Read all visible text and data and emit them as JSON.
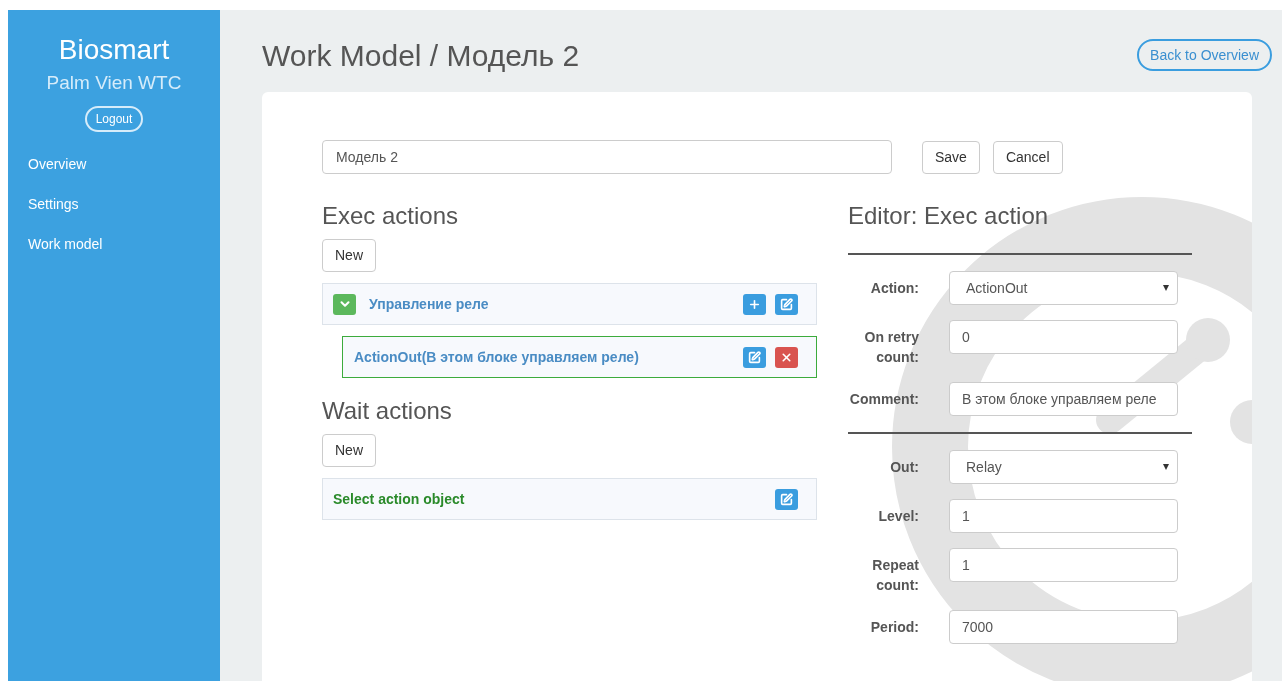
{
  "sidebar": {
    "brand": "Biosmart",
    "site": "Palm Vien WTC",
    "logout": "Logout",
    "items": [
      {
        "label": "Overview"
      },
      {
        "label": "Settings"
      },
      {
        "label": "Work model"
      }
    ]
  },
  "page": {
    "title": "Work Model / Модель 2",
    "back_button": "Back to Overview"
  },
  "model": {
    "name": "Модель 2",
    "buttons": [
      "Save",
      "Cancel"
    ]
  },
  "exec_actions": {
    "title": "Exec actions",
    "new_button": "New",
    "items": [
      {
        "kind": "group",
        "label": "Управление реле",
        "expanded": true,
        "selected": false,
        "children": [
          {
            "kind": "action",
            "label": "ActionOut(В этом блоке управляем реле)",
            "selected": true
          }
        ]
      }
    ]
  },
  "wait_actions": {
    "title": "Wait actions",
    "new_button": "New",
    "items": [
      {
        "kind": "empty",
        "label": "Select action object",
        "selected": false
      }
    ]
  },
  "editor": {
    "title": "Editor: Exec action",
    "sections": [
      {
        "fields": [
          {
            "kind": "select",
            "label": "Action:",
            "value": "ActionOut"
          },
          {
            "kind": "input",
            "label": "On retry count:",
            "value": "0"
          },
          {
            "kind": "input",
            "label": "Comment:",
            "value": "В этом блоке управляем реле"
          }
        ]
      },
      {
        "fields": [
          {
            "kind": "select",
            "label": "Out:",
            "value": "Relay"
          },
          {
            "kind": "input",
            "label": "Level:",
            "value": "1"
          },
          {
            "kind": "input",
            "label": "Repeat count:",
            "value": "1"
          },
          {
            "kind": "input",
            "label": "Period:",
            "value": "7000"
          }
        ]
      }
    ]
  }
}
